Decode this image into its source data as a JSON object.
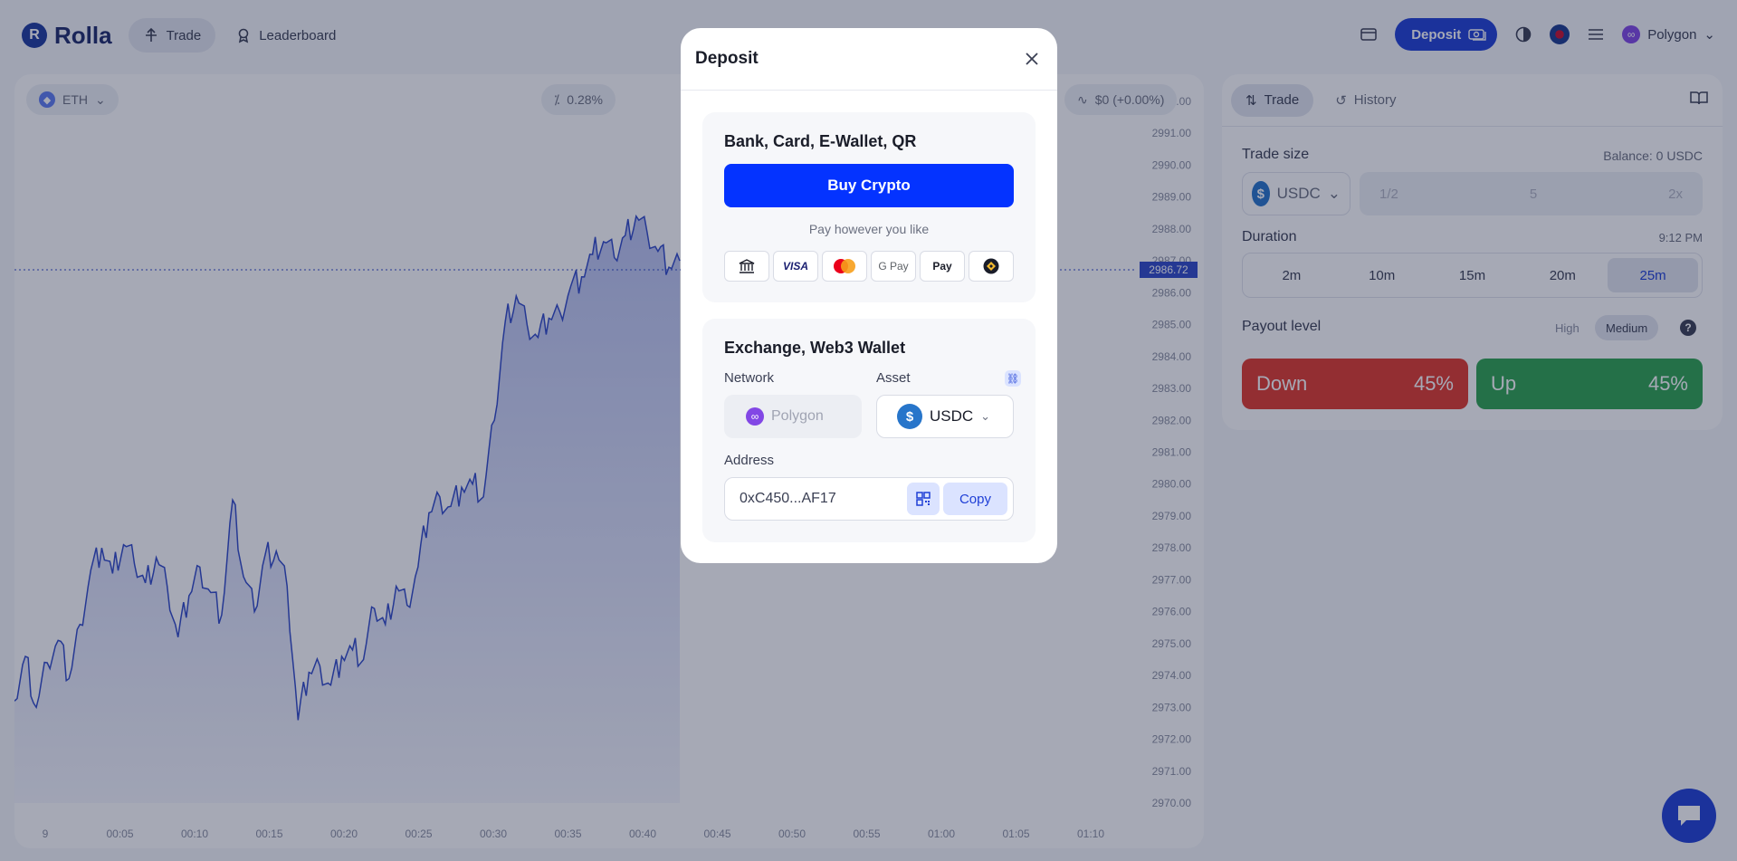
{
  "app": {
    "name": "Rolla"
  },
  "nav": {
    "trade": "Trade",
    "leaderboard": "Leaderboard"
  },
  "header": {
    "deposit": "Deposit",
    "network": "Polygon"
  },
  "chart_toolbar": {
    "asset": "ETH",
    "change": "0.28%",
    "pnl": "$0 (+0.00%)"
  },
  "chart_data": {
    "type": "line",
    "current_price": "2986.72",
    "y_ticks": [
      "2992.00",
      "2991.00",
      "2990.00",
      "2989.00",
      "2988.00",
      "2987.00",
      "2986.00",
      "2985.00",
      "2984.00",
      "2983.00",
      "2982.00",
      "2981.00",
      "2980.00",
      "2979.00",
      "2978.00",
      "2977.00",
      "2976.00",
      "2975.00",
      "2974.00",
      "2973.00",
      "2972.00",
      "2971.00",
      "2970.00"
    ],
    "x_ticks": [
      "9",
      "00:05",
      "00:10",
      "00:15",
      "00:20",
      "00:25",
      "00:30",
      "00:35",
      "00:40",
      "00:45",
      "00:50",
      "00:55",
      "01:00",
      "01:05",
      "01:10"
    ],
    "ylim": [
      2970,
      2992
    ],
    "series": [
      {
        "values": [
          2973.2,
          2974.6,
          2973.0,
          2974.4,
          2975.1,
          2973.9,
          2975.6,
          2977.3,
          2978.0,
          2977.2,
          2978.1,
          2977.5,
          2976.9,
          2977.7,
          2976.8,
          2975.2,
          2976.5,
          2977.4,
          2976.6,
          2975.9,
          2979.5,
          2977.1,
          2976.0,
          2977.8,
          2977.9,
          2976.8,
          2972.6,
          2974.1,
          2974.3,
          2973.7,
          2974.6,
          2974.8,
          2974.5,
          2976.1,
          2975.6,
          2976.8,
          2976.2,
          2977.4,
          2979.1,
          2979.6,
          2979.3,
          2979.9,
          2980.0,
          2979.6,
          2982.0,
          2985.1,
          2985.9,
          2985.0,
          2984.6,
          2985.2,
          2985.4,
          2986.2,
          2986.5,
          2987.2,
          2987.6,
          2987.1,
          2987.8,
          2988.4,
          2987.9,
          2987.3,
          2986.8,
          2987.0
        ]
      }
    ]
  },
  "side": {
    "tabs": [
      "Trade",
      "History"
    ],
    "trade_size_label": "Trade size",
    "balance": "Balance: 0 USDC",
    "currency": "USDC",
    "size_options": [
      "1/2",
      "5",
      "2x"
    ],
    "duration_label": "Duration",
    "duration_time": "9:12 PM",
    "durations": [
      "2m",
      "10m",
      "15m",
      "20m",
      "25m"
    ],
    "payout_label": "Payout level",
    "payout_high": "High",
    "payout_medium": "Medium",
    "down_label": "Down",
    "down_pct": "45%",
    "up_label": "Up",
    "up_pct": "45%"
  },
  "modal": {
    "title": "Deposit",
    "fiat": {
      "title": "Bank, Card, E-Wallet, QR",
      "buy_button": "Buy Crypto",
      "subtitle": "Pay however you like",
      "methods": [
        "bank-icon",
        "VISA",
        "mastercard-icon",
        "G Pay",
        "Pay",
        "binance-icon"
      ]
    },
    "crypto": {
      "title": "Exchange, Web3 Wallet",
      "network_label": "Network",
      "network_value": "Polygon",
      "asset_label": "Asset",
      "asset_value": "USDC",
      "address_label": "Address",
      "address_value": "0xC450...AF17",
      "copy": "Copy"
    }
  },
  "colors": {
    "accent": "#1f3fd6",
    "buy": "#0433ff",
    "down": "#e0392d",
    "up": "#2ea44f",
    "line": "#2f49c8"
  }
}
